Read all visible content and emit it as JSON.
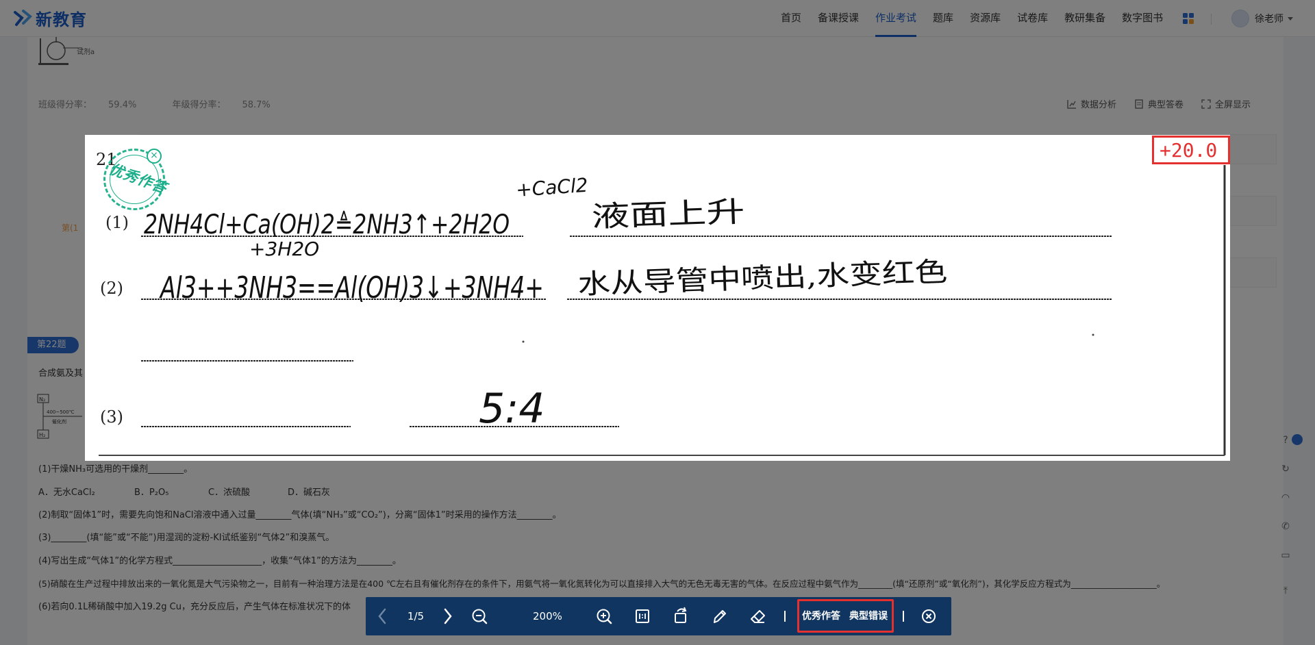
{
  "brand": {
    "logo_text": "新教育"
  },
  "nav": {
    "items": [
      "首页",
      "备课授课",
      "作业考试",
      "题库",
      "资源库",
      "试卷库",
      "教研集备",
      "数字图书"
    ],
    "active_index": 2,
    "user_name": "徐老师"
  },
  "q21": {
    "apparatus_label": "试剂a",
    "class_score_label": "班级得分率：",
    "class_score": "59.4%",
    "grade_score_label": "年级得分率：",
    "grade_score": "58.7%",
    "tools": [
      "数据分析",
      "典型答卷",
      "全屏显示"
    ],
    "side_label": "第(1"
  },
  "q22": {
    "badge": "第22题",
    "intro": "合成氨及其",
    "diagram_labels": [
      "N₂",
      "400~500℃",
      "催化剂",
      "H₂"
    ],
    "q1": "(1)干燥NH₃可选用的干燥剂________。",
    "options": [
      "A．无水CaCl₂",
      "B．P₂O₅",
      "C．浓硫酸",
      "D．碱石灰"
    ],
    "q2": "(2)制取“固体1”时，需要先向饱和NaCl溶液中通入过量________气体(填“NH₃”或“CO₂”)，分离“固体1”时采用的操作方法________。",
    "q3": "(3)________(填“能”或“不能”)用湿润的淀粉-KI试纸鉴别“气体2”和溴蒸气。",
    "q4": "(4)写出生成“气体1”的化学方程式____________________，收集“气体1”的方法为________。",
    "q5": "(5)硝酸在生产过程中排放出来的一氧化氮是大气污染物之一，目前有一种治理方法是在400 ℃左右且有催化剂存在的条件下，用氨气将一氧化氮转化为可以直接排入大气的无色无毒无害的气体。在反应过程中氨气作为________(填“还原剂”或“氧化剂”)，其化学反应方程式为____________________。",
    "q6": "(6)若向0.1L稀硝酸中加入19.2g Cu，充分反应后，产生气体在标准状况下的体"
  },
  "viewer": {
    "score": "+20.0",
    "stamp_text": "优秀作答",
    "handwriting": {
      "question_no": "21",
      "p1_label": "(1)",
      "p1_equation": "2NH4Cl+Ca(OH)2≜2NH3↑+2H2O",
      "p1_above": "+CaCl2",
      "p1_below": "+3H2O",
      "p1_answer": "液面上升",
      "p2_label": "(2)",
      "p2_equation": "Al3++3NH3==Al(OH)3↓+3NH4+",
      "p2_answer": "水从导管中喷出,水变红色",
      "p3_label": "(3)",
      "p3_answer": "5:4"
    }
  },
  "toolbar": {
    "page": "1/5",
    "zoom": "200%",
    "excellent_label": "优秀作答",
    "typical_error_label": "典型错误"
  },
  "colors": {
    "primary": "#1d5fcc",
    "toolbar_bg": "#0f3560",
    "highlight": "#e53030",
    "stamp": "#1aae8a"
  }
}
